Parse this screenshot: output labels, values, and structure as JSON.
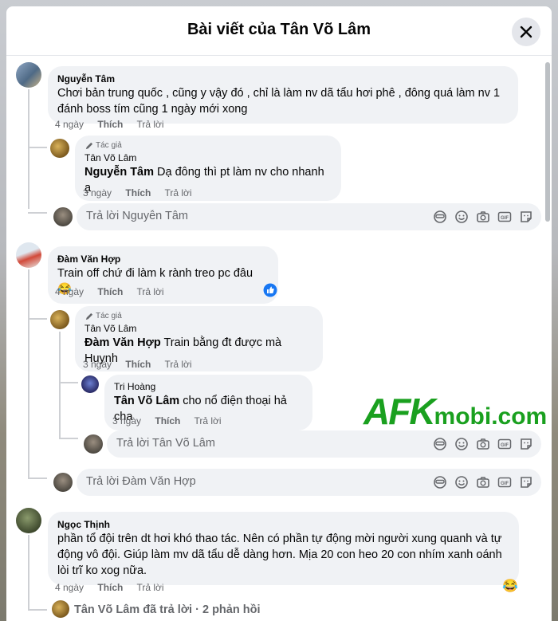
{
  "header": {
    "title": "Bài viết của Tân Võ Lâm"
  },
  "labels": {
    "like": "Thích",
    "reply": "Trả lời",
    "author_badge": "Tác giả"
  },
  "comments": [
    {
      "name": "Nguyễn Tâm",
      "text_line1": "Chơi bản trung quốc , cũng y vậy đó , chỉ là làm nv dã tẩu hơi phê , đông quá làm nv 1",
      "text_line2": "đánh boss tím cũng 1 ngày mới xong",
      "time": "4 ngày",
      "reply": {
        "name": "Tân Võ Lâm",
        "tag": "Nguyễn Tâm",
        "text": " Dạ đông thì pt làm nv cho nhanh ạ",
        "time": "3 ngày"
      },
      "reply_placeholder": "Trả lời Nguyễn Tâm"
    },
    {
      "name": "Đàm Văn Hợp",
      "text": "Train off chứ đi làm k rành treo pc đâu ",
      "emoji": "😂",
      "time": "4 ngày",
      "reply": {
        "name": "Tân Võ Lâm",
        "tag": "Đàm Văn Hợp",
        "text": " Train bằng đt được mà Huynh",
        "time": "3 ngày"
      },
      "subreply": {
        "name": "Tri Hoàng",
        "tag": "Tân Võ Lâm",
        "text": " cho nổ điện thoại hả cha",
        "time": "3 ngày"
      },
      "subreply_placeholder": "Trả lời Tân Võ Lâm",
      "reply_placeholder": "Trả lời Đàm Văn Hợp"
    },
    {
      "name": "Ngọc Thịnh",
      "text_line1": "phần tổ đội trên dt hơi khó thao tác. Nên có phần tự động mời người xung quanh và tự",
      "text_line2": "động vô đội. Giúp làm mv dã tẩu dễ dàng hơn. Mịa 20 con heo 20 con nhím xanh oánh",
      "text_line3": "lòi trĩ ko xog nữa.",
      "time": "4 ngày",
      "replies_summary": "Tân Võ Lâm đã trả lời · 2 phản hồi"
    }
  ],
  "watermark": {
    "afk": "AFK",
    "mobi": "mobi.com"
  },
  "colors": {
    "fb_blue": "#1877f2",
    "watermark_green": "#1aa01f"
  }
}
